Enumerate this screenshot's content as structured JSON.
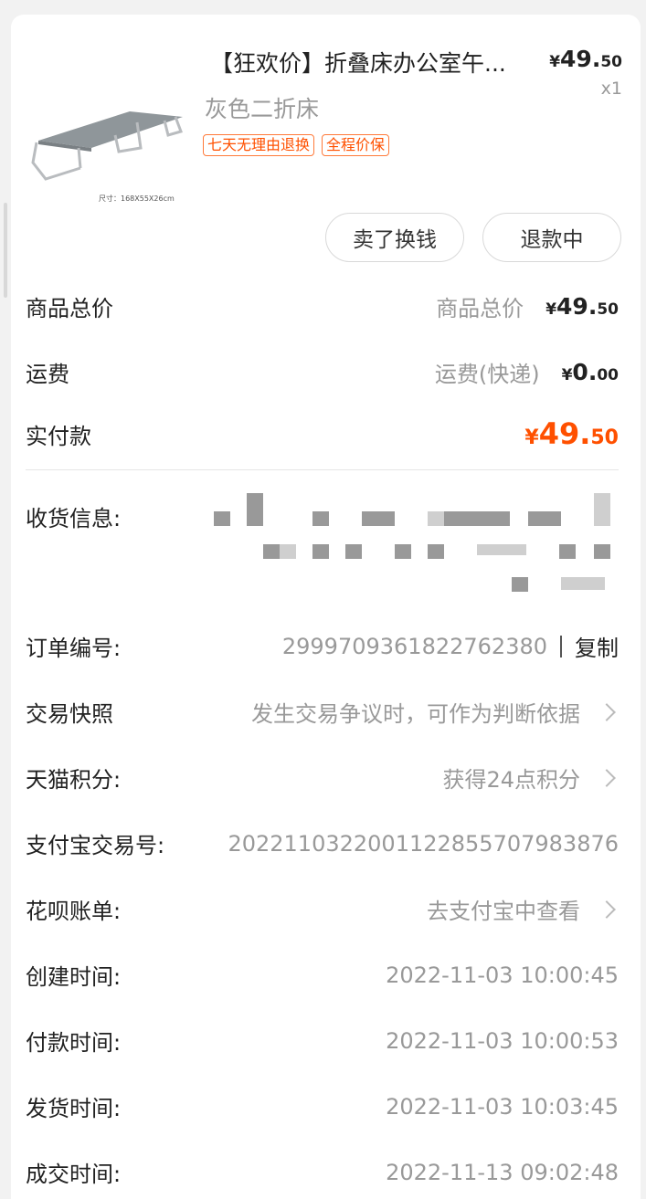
{
  "product": {
    "title": "【狂欢价】折叠床办公室午...",
    "price_yen": "¥",
    "price_int": "49.",
    "price_dec": "50",
    "quantity": "x1",
    "sku": "灰色二折床",
    "image_caption": "尺寸：168X55X26cm",
    "tags": [
      "七天无理由退换",
      "全程价保"
    ]
  },
  "actions": {
    "sell_label": "卖了换钱",
    "refund_label": "退款中"
  },
  "summary": {
    "goods_total": {
      "label": "商品总价",
      "sub": "商品总价",
      "yen": "¥",
      "int": "49.",
      "dec": "50"
    },
    "shipping": {
      "label": "运费",
      "sub": "运费(快递)",
      "yen": "¥",
      "int": "0.",
      "dec": "00"
    },
    "paid": {
      "label": "实付款",
      "yen": "¥",
      "int": "49.",
      "dec": "50",
      "color": "#ff5000"
    }
  },
  "details": {
    "shipping_info_label": "收货信息:",
    "order_no": {
      "label": "订单编号:",
      "value": "2999709361822762380",
      "copy": "复制"
    },
    "snapshot": {
      "label": "交易快照",
      "value": "发生交易争议时，可作为判断依据"
    },
    "points": {
      "label": "天猫积分:",
      "value": "获得24点积分"
    },
    "alipay_no": {
      "label": "支付宝交易号:",
      "value": "2022110322001122855707983876"
    },
    "huabei": {
      "label": "花呗账单:",
      "value": "去支付宝中查看"
    },
    "created": {
      "label": "创建时间:",
      "value": "2022-11-03 10:00:45"
    },
    "paid_time": {
      "label": "付款时间:",
      "value": "2022-11-03 10:00:53"
    },
    "shipped": {
      "label": "发货时间:",
      "value": "2022-11-03 10:03:45"
    },
    "closed": {
      "label": "成交时间:",
      "value": "2022-11-13 09:02:48"
    }
  },
  "colors": {
    "accent": "#ff5000",
    "muted": "#999999",
    "text": "#222222"
  }
}
